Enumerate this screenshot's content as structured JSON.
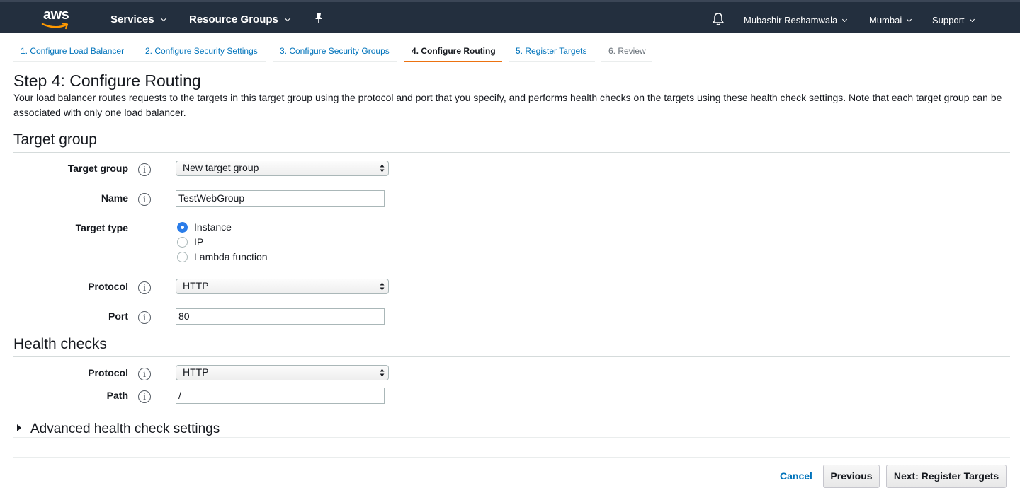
{
  "topnav": {
    "logo_text": "aws",
    "services": "Services",
    "resource_groups": "Resource Groups",
    "user": "Mubashir Reshamwala",
    "region": "Mumbai",
    "support": "Support"
  },
  "tabs": [
    {
      "label": "1. Configure Load Balancer",
      "state": "link"
    },
    {
      "label": "2. Configure Security Settings",
      "state": "link"
    },
    {
      "label": "3. Configure Security Groups",
      "state": "link"
    },
    {
      "label": "4. Configure Routing",
      "state": "active"
    },
    {
      "label": "5. Register Targets",
      "state": "link"
    },
    {
      "label": "6. Review",
      "state": "disabled"
    }
  ],
  "page": {
    "title": "Step 4: Configure Routing",
    "description": "Your load balancer routes requests to the targets in this target group using the protocol and port that you specify, and performs health checks on the targets using these health check settings. Note that each target group can be associated with only one load balancer."
  },
  "target_group": {
    "heading": "Target group",
    "target_group_label": "Target group",
    "target_group_value": "New target group",
    "name_label": "Name",
    "name_value": "TestWebGroup",
    "target_type_label": "Target type",
    "target_type_options": [
      "Instance",
      "IP",
      "Lambda function"
    ],
    "target_type_selected": "Instance",
    "protocol_label": "Protocol",
    "protocol_value": "HTTP",
    "port_label": "Port",
    "port_value": "80"
  },
  "health_checks": {
    "heading": "Health checks",
    "protocol_label": "Protocol",
    "protocol_value": "HTTP",
    "path_label": "Path",
    "path_value": "/",
    "advanced_label": "Advanced health check settings"
  },
  "info_icon_text": "i",
  "footer": {
    "cancel": "Cancel",
    "previous": "Previous",
    "next": "Next: Register Targets"
  },
  "colors": {
    "nav_bg": "#232f3e",
    "link": "#0073bb",
    "active_tab_underline": "#ec7211",
    "radio_checked": "#2b7de9",
    "smile": "#ff9900"
  }
}
